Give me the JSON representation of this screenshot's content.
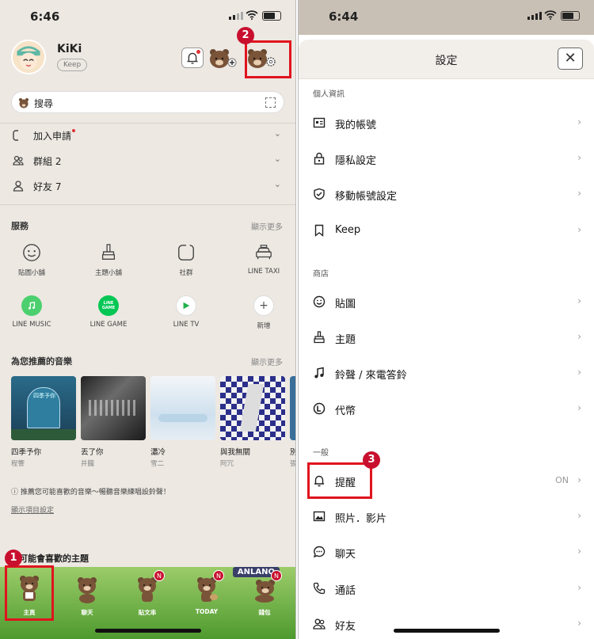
{
  "left": {
    "status": {
      "time": "6:46"
    },
    "profile": {
      "name": "KiKi",
      "keep": "Keep"
    },
    "search": {
      "label": "搜尋"
    },
    "rows": [
      {
        "label": "加入申請"
      },
      {
        "label": "群組 2"
      },
      {
        "label": "好友 7"
      }
    ],
    "services": {
      "title": "服務",
      "more": "顯示更多",
      "items": [
        {
          "label": "貼圖小舖",
          "icon": "smiley-icon"
        },
        {
          "label": "主題小舖",
          "icon": "brush-icon"
        },
        {
          "label": "社群",
          "icon": "community-icon"
        },
        {
          "label": "LINE TAXI",
          "icon": "taxi-icon"
        },
        {
          "label": "LINE MUSIC",
          "icon": "music-icon"
        },
        {
          "label": "LINE GAME",
          "icon": "game-icon"
        },
        {
          "label": "LINE TV",
          "icon": "play-icon"
        },
        {
          "label": "新增",
          "icon": "plus-icon"
        }
      ],
      "game_logo_text": "LINE\nGAME"
    },
    "music": {
      "title": "為您推薦的音樂",
      "more": "顯示更多",
      "cover_text": "四季予你",
      "items": [
        {
          "title": "四季予你",
          "artist": "程響"
        },
        {
          "title": "丟了你",
          "artist": "井朧"
        },
        {
          "title": "瀟冷",
          "artist": "雪二"
        },
        {
          "title": "與我無關",
          "artist": "阿冗"
        },
        {
          "title": "別",
          "artist": "張"
        }
      ]
    },
    "note": "ⓘ 推薦您可能喜歡的音樂～暢聽音樂練唱設鈴聲！",
    "note_link": "顯示項目設定",
    "themes_title": "可能會喜歡的主題",
    "banner_text": "ANLANO",
    "tabs": [
      {
        "label": "主頁",
        "badge": ""
      },
      {
        "label": "聊天",
        "badge": ""
      },
      {
        "label": "貼文串",
        "badge": "N"
      },
      {
        "label": "TODAY",
        "badge": "N"
      },
      {
        "label": "錢包",
        "badge": "N"
      }
    ],
    "markers": {
      "one": "1",
      "two": "2"
    }
  },
  "right": {
    "status": {
      "time": "6:44"
    },
    "title": "設定",
    "close": "✕",
    "sections": [
      {
        "title": "個人資訊"
      },
      {
        "title": "商店"
      },
      {
        "title": "一般"
      }
    ],
    "items": [
      {
        "label": "我的帳號",
        "icon": "id-card-icon"
      },
      {
        "label": "隱私設定",
        "icon": "lock-icon"
      },
      {
        "label": "移動帳號設定",
        "icon": "shield-icon"
      },
      {
        "label": "Keep",
        "icon": "bookmark-icon"
      },
      {
        "label": "貼圖",
        "icon": "smiley-icon"
      },
      {
        "label": "主題",
        "icon": "brush-icon"
      },
      {
        "label": "鈴聲 / 來電答鈴",
        "icon": "music-note-icon"
      },
      {
        "label": "代幣",
        "icon": "coin-icon"
      },
      {
        "label": "提醒",
        "icon": "bell-icon",
        "value": "ON"
      },
      {
        "label": "照片．影片",
        "icon": "photo-icon"
      },
      {
        "label": "聊天",
        "icon": "chat-icon"
      },
      {
        "label": "通話",
        "icon": "phone-icon"
      },
      {
        "label": "好友",
        "icon": "friends-icon"
      }
    ],
    "markers": {
      "three": "3"
    }
  },
  "colors": {
    "highlight": "#e0141e",
    "marker": "#c8102e",
    "line_green": "#06c755",
    "left_bg": "#ede8e2"
  }
}
